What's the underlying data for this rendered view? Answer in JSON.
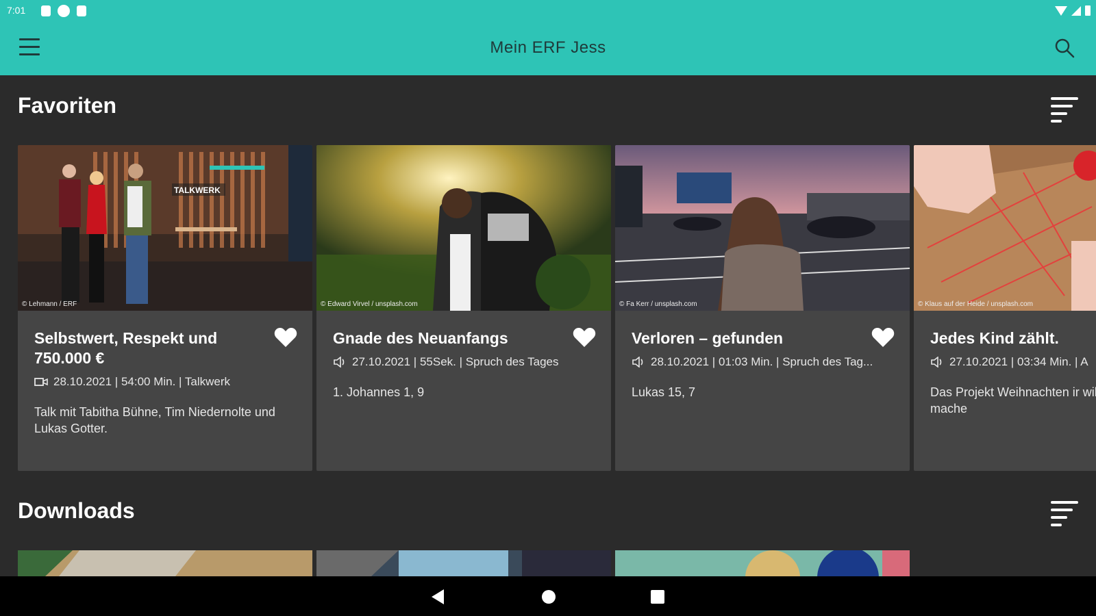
{
  "status_bar": {
    "time": "7:01"
  },
  "app_bar": {
    "title": "Mein ERF Jess"
  },
  "sections": {
    "favorites": {
      "title": "Favoriten",
      "cards": [
        {
          "image_credit": "© Lehmann / ERF",
          "title": "Selbstwert, Respekt und 750.000 €",
          "media_type": "video",
          "meta": "28.10.2021 | 54:00 Min. | Talkwerk",
          "description": "Talk mit Tabitha Bühne, Tim Niedernolte und Lukas Gotter."
        },
        {
          "image_credit": "© Edward Virvel / unsplash.com",
          "title": "Gnade des Neuanfangs",
          "media_type": "audio",
          "meta": "27.10.2021 | 55Sek. | Spruch des Tages",
          "description": "1. Johannes 1, 9"
        },
        {
          "image_credit": "© Fa Kerr / unsplash.com",
          "title": "Verloren – gefunden",
          "media_type": "audio",
          "meta": "28.10.2021 | 01:03 Min. | Spruch des Tag...",
          "description": "Lukas 15, 7"
        },
        {
          "image_credit": "© Klaus auf der Heide / unsplash.com",
          "title": "Jedes Kind zählt.",
          "media_type": "audio",
          "meta": "27.10.2021 | 03:34 Min. | A",
          "description": "Das Projekt Weihnachten ir will Kinder glücklich mache"
        }
      ]
    },
    "downloads": {
      "title": "Downloads"
    }
  },
  "colors": {
    "accent": "#2ec4b6",
    "background": "#2b2b2b",
    "card": "#454545"
  }
}
